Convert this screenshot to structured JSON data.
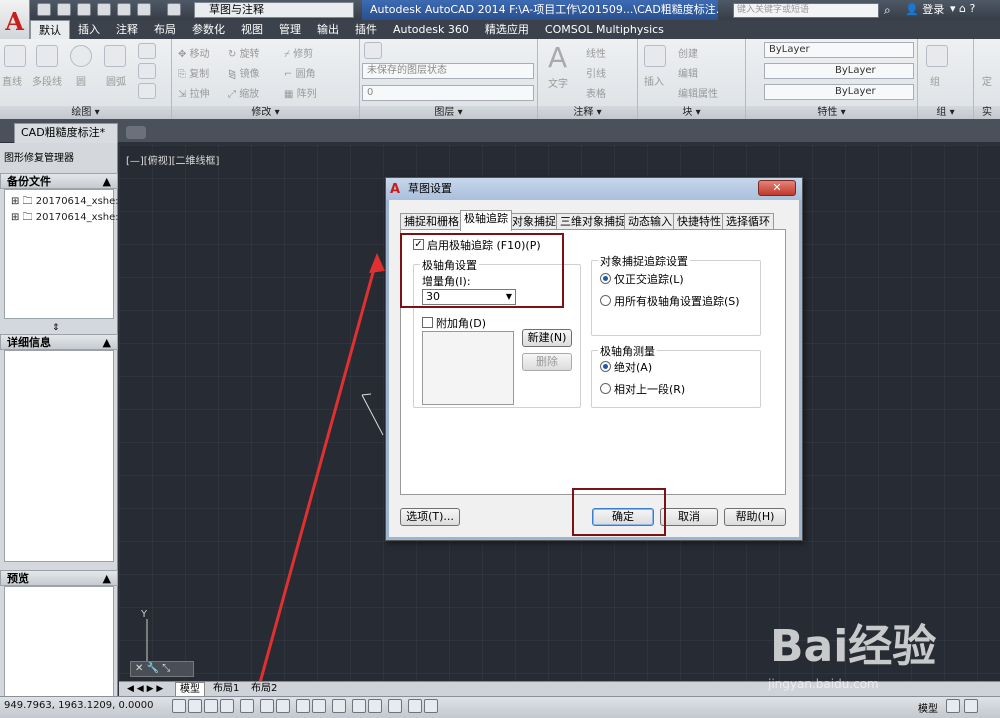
{
  "app": {
    "workspace": "草图与注释",
    "title": "Autodesk AutoCAD 2014     F:\\A-项目工作\\201509...\\CAD粗糙度标注.dwg",
    "search_placeholder": "键入关键字或短语",
    "login": "登录"
  },
  "ribbon_tabs": [
    "默认",
    "插入",
    "注释",
    "布局",
    "参数化",
    "视图",
    "管理",
    "输出",
    "插件",
    "Autodesk 360",
    "精选应用",
    "COMSOL Multiphysics"
  ],
  "ribbon": {
    "draw": {
      "title": "绘图 ▾",
      "items": [
        "直线",
        "多段线",
        "圆",
        "圆弧"
      ]
    },
    "modify": {
      "title": "修改 ▾",
      "items": [
        "移动",
        "旋转",
        "修剪",
        "复制",
        "镜像",
        "圆角",
        "拉伸",
        "缩放",
        "阵列"
      ]
    },
    "layers": {
      "title": "图层 ▾",
      "state": "未保存的图层状态",
      "current": "0"
    },
    "annotation": {
      "title": "注释 ▾",
      "items": [
        "文字",
        "线性",
        "引线",
        "表格"
      ]
    },
    "block": {
      "title": "块 ▾",
      "items": [
        "插入",
        "创建",
        "编辑",
        "编辑属性"
      ]
    },
    "properties": {
      "title": "特性 ▾",
      "bylayer1": "ByLayer",
      "bylayer2": "ByLayer",
      "bylayer3": "ByLayer"
    },
    "group": {
      "title": "组 ▾",
      "item": "组"
    },
    "util": {
      "title": "实",
      "item": "定"
    }
  },
  "document_tab": "CAD粗糙度标注*",
  "palette": {
    "title": "图形修复管理器",
    "backup_header": "备份文件",
    "backup_items": [
      "20170614_xshe:",
      "20170614_xshe:"
    ],
    "details_header": "详细信息",
    "preview_header": "预览"
  },
  "viewport_label": "[—][俯视][二维线框]",
  "model_tabs": [
    "模型",
    "布局1",
    "布局2"
  ],
  "status": {
    "coords": "949.7963,  1963.1209,  0.0000",
    "model": "模型"
  },
  "dialog": {
    "title": "草图设置",
    "tabs": [
      "捕捉和栅格",
      "极轴追踪",
      "对象捕捉",
      "三维对象捕捉",
      "动态输入",
      "快捷特性",
      "选择循环"
    ],
    "enable_polar": "启用极轴追踪 (F10)(P)",
    "polar_angle_group": "极轴角设置",
    "increment_label": "增量角(I):",
    "increment_value": "30",
    "additional_angle": "附加角(D)",
    "new_button": "新建(N)",
    "delete_button": "删除",
    "snap_tracking_group": "对象捕捉追踪设置",
    "ortho_only": "仅正交追踪(L)",
    "all_polar": "用所有极轴角设置追踪(S)",
    "measure_group": "极轴角测量",
    "absolute": "绝对(A)",
    "relative": "相对上一段(R)",
    "options_button": "选项(T)...",
    "ok_button": "确定",
    "cancel_button": "取消",
    "help_button": "帮助(H)"
  },
  "watermark": {
    "main": "Bai经验",
    "sub": "jingyan.baidu.com"
  },
  "colors": {
    "canvas": "#272b33",
    "accent_red": "#7a1216",
    "arrow_red": "#e03030"
  }
}
